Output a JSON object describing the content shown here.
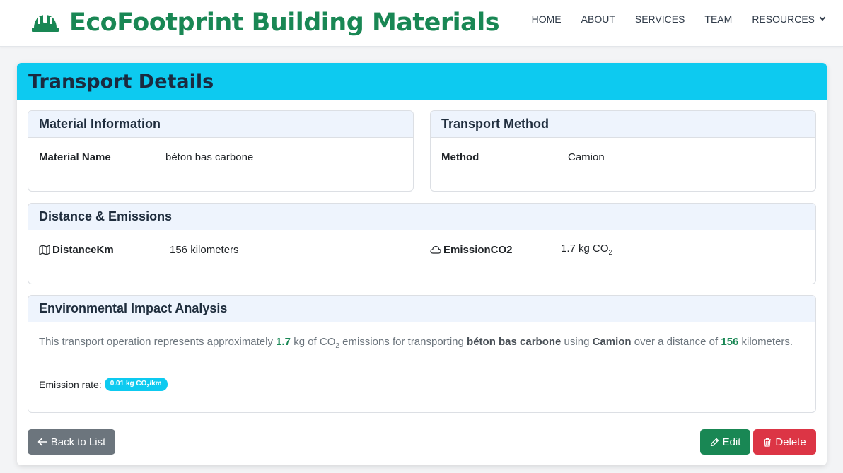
{
  "brand": {
    "name": "EcoFootprint Building Materials",
    "icon": "hard-hat-icon",
    "color": "#198754"
  },
  "nav": [
    {
      "label": "HOME"
    },
    {
      "label": "ABOUT"
    },
    {
      "label": "SERVICES"
    },
    {
      "label": "TEAM"
    },
    {
      "label": "RESOURCES",
      "icon": "chevron-down-icon"
    }
  ],
  "page": {
    "title": "Transport Details",
    "header_color": "#0dcaf0"
  },
  "material_info": {
    "title": "Material Information",
    "label": "Material Name",
    "value": "béton bas carbone"
  },
  "transport_method": {
    "title": "Transport Method",
    "label": "Method",
    "value": "Camion"
  },
  "distance_emissions": {
    "title": "Distance & Emissions",
    "distance_label": "DistanceKm",
    "distance_icon": "map-icon",
    "distance_value": "156 kilometers",
    "emission_label": "EmissionCO2",
    "emission_icon": "cloud-icon",
    "emission_value_prefix": "1.7 kg CO",
    "emission_value_sub": "2"
  },
  "impact": {
    "title": "Environmental Impact Analysis",
    "text_1": "This transport operation represents approximately ",
    "co2_amount": "1.7",
    "text_2": " kg of CO",
    "text_2_sub": "2",
    "text_3": " emissions for transporting ",
    "material": "béton bas carbone",
    "text_4": " using ",
    "method": "Camion",
    "text_5": " over a distance of ",
    "distance": "156",
    "text_6": " kilometers.",
    "rate_label": "Emission rate:",
    "rate_badge_prefix": "0.01 kg CO",
    "rate_badge_sub": "2",
    "rate_badge_suffix": "/km"
  },
  "actions": {
    "back": {
      "label": "Back to List",
      "icon": "arrow-left-icon"
    },
    "edit": {
      "label": "Edit",
      "icon": "pencil-icon",
      "color": "#198754"
    },
    "delete": {
      "label": "Delete",
      "icon": "trash-icon",
      "color": "#dc3545"
    }
  }
}
